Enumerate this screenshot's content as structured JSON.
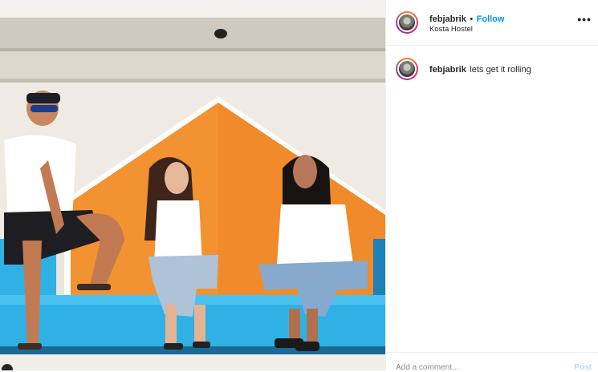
{
  "post": {
    "username": "febjabrik",
    "separator": "•",
    "follow_label": "Follow",
    "location": "Kosta Hostel",
    "more_icon": "more-horizontal-icon",
    "caption_username": "febjabrik",
    "caption_text": "lets get it rolling",
    "comment_placeholder": "Add a comment...",
    "post_label": "Post"
  },
  "colors": {
    "accent": "#0095f6",
    "orange_wall": "#f08a2a",
    "bench_blue": "#2fb1e6"
  }
}
